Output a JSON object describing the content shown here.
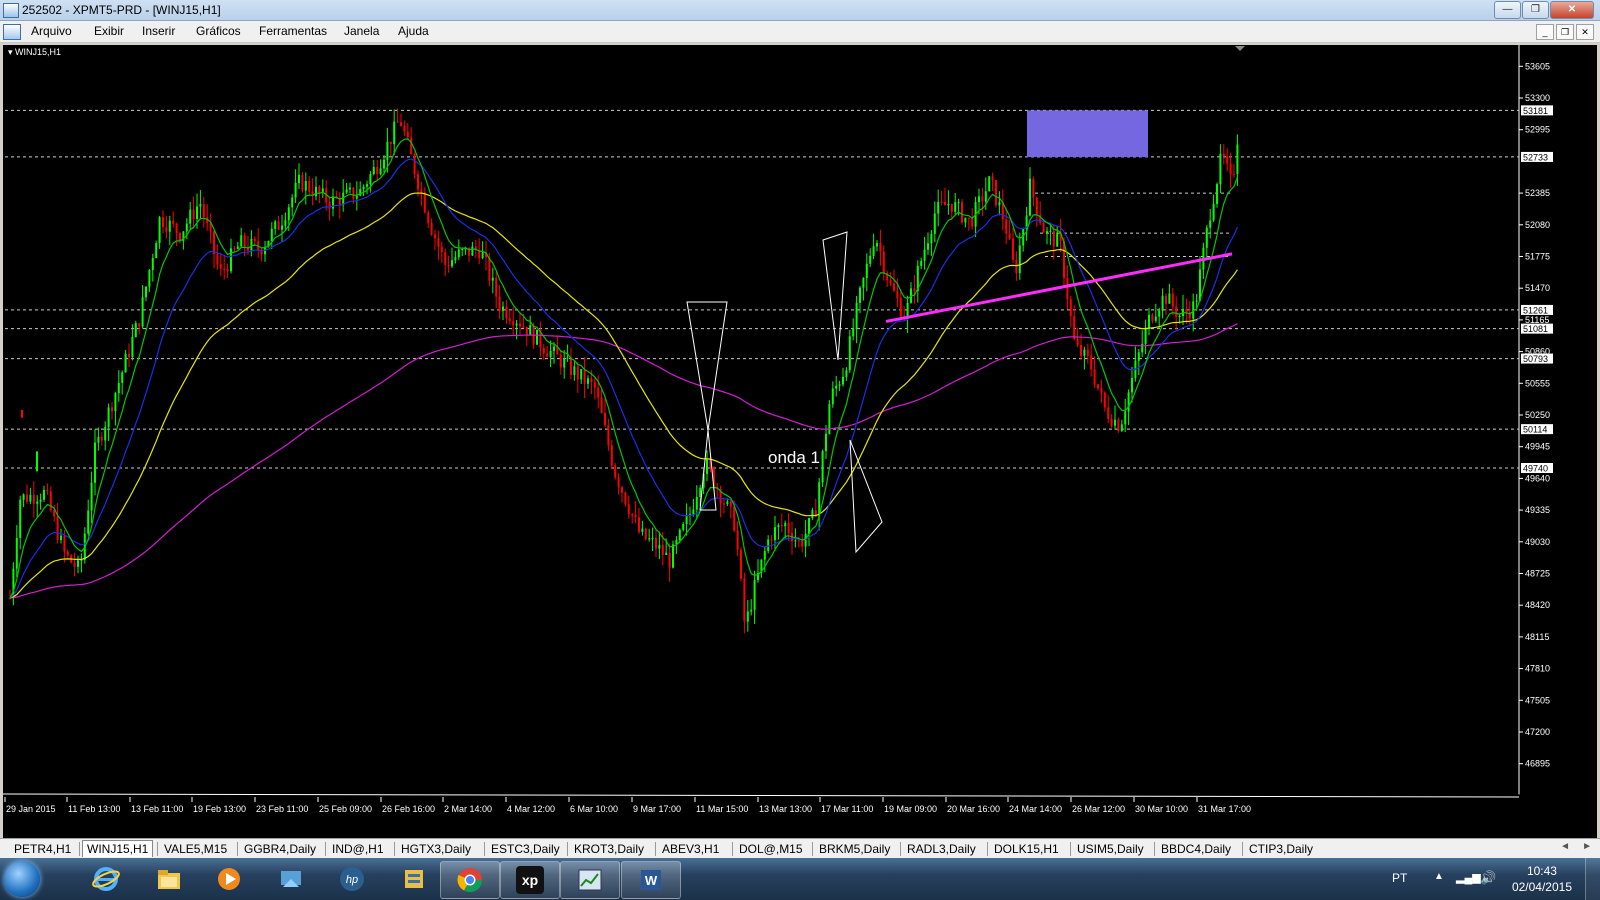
{
  "window": {
    "title": "252502 - XPMT5-PRD - [WINJ15,H1]",
    "min": "0",
    "max": "1",
    "close": "r"
  },
  "menu": [
    "Arquivo",
    "Exibir",
    "Inserir",
    "Gráficos",
    "Ferramentas",
    "Janela",
    "Ajuda"
  ],
  "mdi": {
    "min": "_",
    "restore": "❐",
    "close": "✕"
  },
  "chart": {
    "symbol": "WINJ15,H1",
    "annotation": "onda 1",
    "price_ticks": [
      "53605",
      "53300",
      "52995",
      "52385",
      "52080",
      "51775",
      "51470",
      "51165",
      "50860",
      "50555",
      "50250",
      "49945",
      "49640",
      "49335",
      "49030",
      "48725",
      "48420",
      "48115",
      "47810",
      "47505",
      "47200",
      "46895"
    ],
    "price_marks": [
      "53181",
      "52733",
      "51261",
      "51081",
      "50793",
      "50114",
      "49740"
    ],
    "time_ticks": [
      "29 Jan 2015",
      "11 Feb 13:00",
      "13 Feb 11:00",
      "19 Feb 13:00",
      "23 Feb 11:00",
      "25 Feb 09:00",
      "26 Feb 16:00",
      "2 Mar 14:00",
      "4 Mar 12:00",
      "6 Mar 10:00",
      "9 Mar 17:00",
      "11 Mar 15:00",
      "13 Mar 13:00",
      "17 Mar 11:00",
      "19 Mar 09:00",
      "20 Mar 16:00",
      "24 Mar 14:00",
      "26 Mar 12:00",
      "30 Mar 10:00",
      "31 Mar 17:00"
    ],
    "colors": {
      "bull": "#00ff00",
      "bear": "#ff0000",
      "ma_fast": "#00c800",
      "ma_blue": "#1c2ee6",
      "ma_yellow": "#e6e600",
      "ma_magenta": "#d21ed2",
      "trend": "#ff2bff",
      "box": "#7467e0"
    }
  },
  "tabs": [
    "PETR4,H1",
    "WINJ15,H1",
    "VALE5,M15",
    "GGBR4,Daily",
    "IND@,H1",
    "HGTX3,Daily",
    "ESTC3,Daily",
    "KROT3,Daily",
    "ABEV3,H1",
    "DOL@,M15",
    "BRKM5,Daily",
    "RADL3,Daily",
    "DOLK15,H1",
    "USIM5,Daily",
    "BBDC4,Daily",
    "CTIP3,Daily"
  ],
  "tabs_active": 1,
  "taskbar": {
    "lang": "PT",
    "time": "10:43",
    "date": "02/04/2015",
    "xp_label": "xp"
  }
}
